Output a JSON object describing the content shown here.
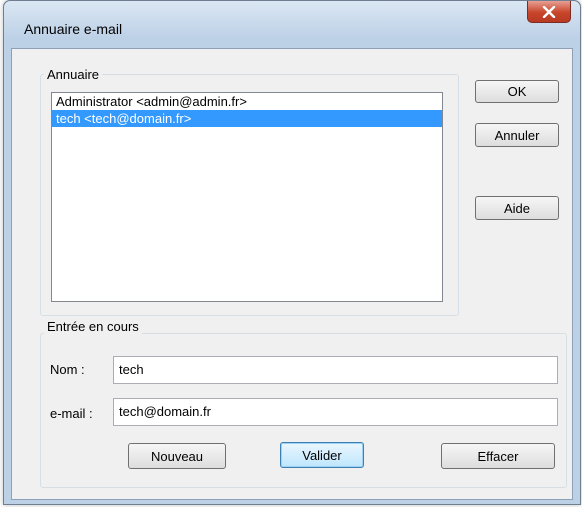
{
  "window": {
    "title": "Annuaire e-mail",
    "close_icon": "close-icon"
  },
  "annuaire": {
    "legend": "Annuaire",
    "entries": [
      {
        "text": "Administrator <admin@admin.fr>",
        "selected": false
      },
      {
        "text": "tech <tech@domain.fr>",
        "selected": true
      }
    ]
  },
  "buttons": {
    "ok": "OK",
    "cancel": "Annuler",
    "help": "Aide"
  },
  "entree": {
    "legend": "Entrée en cours",
    "name_label": "Nom :",
    "name_value": "tech",
    "email_label": "e-mail :",
    "email_value": "tech@domain.fr",
    "new_button": "Nouveau",
    "validate_button": "Valider",
    "clear_button": "Effacer"
  },
  "colors": {
    "selection": "#3399ff",
    "close_button": "#c8452b"
  }
}
